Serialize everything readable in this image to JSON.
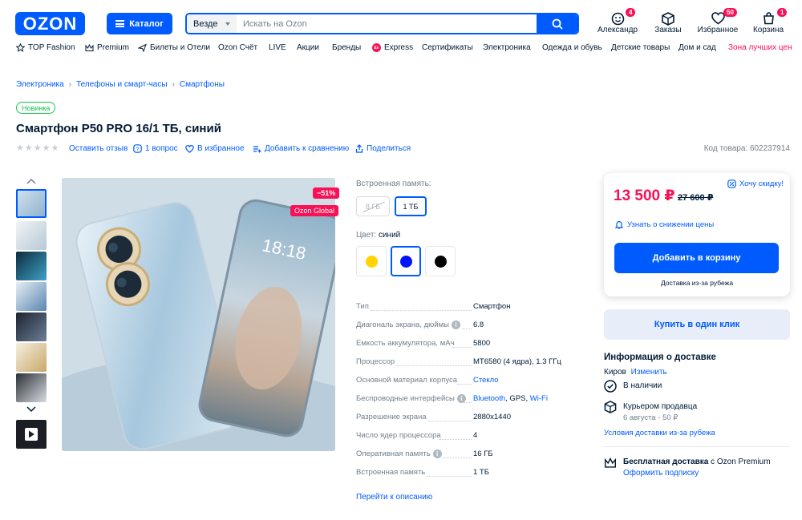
{
  "header": {
    "logo_text": "OZON",
    "catalog_label": "Каталог",
    "search_scope": "Везде",
    "search_placeholder": "Искать на Ozon",
    "icons": [
      {
        "label": "Александр",
        "icon": "user-icon",
        "badge": "4"
      },
      {
        "label": "Заказы",
        "icon": "box-icon",
        "badge": ""
      },
      {
        "label": "Избранное",
        "icon": "heart-icon",
        "badge": "50"
      },
      {
        "label": "Корзина",
        "icon": "cart-icon",
        "badge": "1"
      }
    ]
  },
  "nav": {
    "items": [
      {
        "label": "TOP Fashion",
        "icon": "star-icon"
      },
      {
        "label": "Premium",
        "icon": "crown-icon"
      },
      {
        "label": "Билеты и Отели",
        "icon": "plane-icon"
      },
      {
        "label": "Ozon Счёт",
        "icon": ""
      },
      {
        "label": "LIVE",
        "icon": ""
      },
      {
        "label": "Акции",
        "icon": ""
      },
      {
        "label": "Бренды",
        "icon": ""
      },
      {
        "label": "Express",
        "icon": "express-icon"
      },
      {
        "label": "Сертификаты",
        "icon": ""
      },
      {
        "label": "Электроника",
        "icon": ""
      },
      {
        "label": "Одежда и обувь",
        "icon": ""
      },
      {
        "label": "Детские товары",
        "icon": ""
      },
      {
        "label": "Дом и сад",
        "icon": ""
      },
      {
        "label": "Зона лучших цен",
        "icon": ""
      }
    ]
  },
  "breadcrumbs": [
    "Электроника",
    "Телефоны и смарт-часы",
    "Смартфоны"
  ],
  "product": {
    "badge": "Новинка",
    "title": "Смартфон P50 PRO 16/1 ТБ, синий",
    "leave_review": "Оставить отзыв",
    "questions": "1 вопрос",
    "favorite": "В избранное",
    "compare": "Добавить к сравнению",
    "share": "Поделиться",
    "sku": "Код товара: 602237914",
    "discount_badge": "−51%",
    "global_badge": "Ozon Global",
    "rating_stars": 0
  },
  "options": {
    "memory_label": "Встроенная память:",
    "memory_values": [
      {
        "label": "8 ГБ",
        "state": "disabled"
      },
      {
        "label": "1 ТБ",
        "state": "active"
      }
    ],
    "color_label": "Цвет:",
    "color_value": "синий",
    "colors": [
      {
        "name": "yellow",
        "hex": "#ffd400",
        "active": false
      },
      {
        "name": "blue",
        "hex": "#0011ff",
        "active": true
      },
      {
        "name": "black",
        "hex": "#000000",
        "active": false
      }
    ]
  },
  "specs": [
    {
      "name": "Тип",
      "value": "Смартфон",
      "info": false,
      "link": false
    },
    {
      "name": "Диагональ экрана, дюймы",
      "value": "6.8",
      "info": true,
      "link": false
    },
    {
      "name": "Емкость аккумулятора, мАч",
      "value": "5800",
      "info": false,
      "link": false
    },
    {
      "name": "Процессор",
      "value": "MT6580 (4 ядра), 1.3 ГГц",
      "info": false,
      "link": false
    },
    {
      "name": "Основной материал корпуса",
      "value": "Стекло",
      "info": false,
      "link": true
    },
    {
      "name": "Беспроводные интерфейсы",
      "value_parts": [
        "Bluetooth",
        ", GPS, ",
        "Wi-Fi"
      ],
      "info": true,
      "link": true
    },
    {
      "name": "Разрешение экрана",
      "value": "2880x1440",
      "info": false,
      "link": false
    },
    {
      "name": "Число ядер процессора",
      "value": "4",
      "info": false,
      "link": false
    },
    {
      "name": "Оперативная память",
      "value": "16 ГБ",
      "info": true,
      "link": false
    },
    {
      "name": "Встроенная память",
      "value": "1 ТБ",
      "info": false,
      "link": false
    }
  ],
  "to_description": "Перейти к описанию",
  "purchase": {
    "price": "13 500 ₽",
    "old_price": "27 600 ₽",
    "want_discount": "Хочу скидку!",
    "notify": "Узнать о снижении цены",
    "add_to_cart": "Добавить в корзину",
    "delivery_note": "Доставка из-за рубежа",
    "buy_one_click": "Купить в один клик"
  },
  "delivery": {
    "title": "Информация о доставке",
    "city": "Киров",
    "change": "Изменить",
    "in_stock": "В наличии",
    "courier": "Курьером продавца",
    "courier_detail": "6 августа - 50 ₽",
    "conditions": "Условия доставки из-за рубежа",
    "premium_bold": "Бесплатная доставка",
    "premium_rest": " с Ozon Premium",
    "premium_link": "Оформить подписку"
  },
  "colors": {
    "accent": "#005bff",
    "price": "#f91155",
    "new": "#10c44c",
    "text": "#001a34",
    "muted": "#707f8d"
  }
}
